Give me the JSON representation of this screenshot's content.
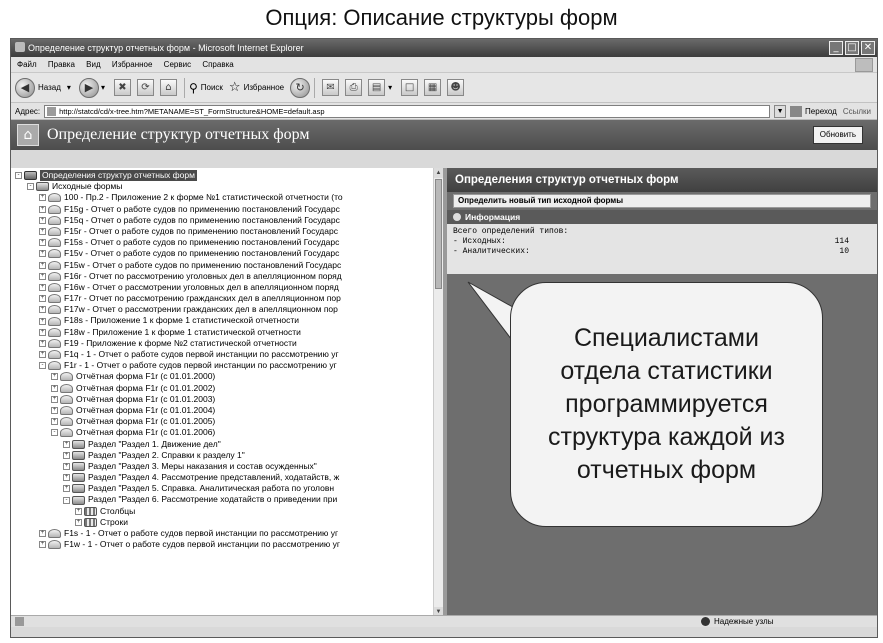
{
  "slide_title": "Опция: Описание структуры форм",
  "window": {
    "title": "Определение структур отчетных форм - Microsoft Internet Explorer",
    "controls": [
      "_",
      "□",
      "✕"
    ]
  },
  "menu": [
    "Файл",
    "Правка",
    "Вид",
    "Избранное",
    "Сервис",
    "Справка"
  ],
  "toolbar": {
    "back": "Назад",
    "search": "Поиск",
    "favorites": "Избранное"
  },
  "address": {
    "label": "Адрес:",
    "url": "http://statcd/cd/x-tree.htm?METANAME=ST_FormStructure&HOME=default.asp",
    "go": "Переход",
    "links": "Ссылки"
  },
  "app": {
    "title": "Определение структур отчетных форм",
    "refresh_label": "Обновить"
  },
  "tree": [
    {
      "exp": "-",
      "icon": "db",
      "label": "Определения структур отчетных форм",
      "indent": 0,
      "selected": true
    },
    {
      "exp": "-",
      "icon": "folder",
      "label": "Исходные формы",
      "indent": 1
    },
    {
      "exp": "+",
      "icon": "doc",
      "label": "100 - Пр.2 - Приложение 2 к форме №1 статистической отчетности (то",
      "indent": 2
    },
    {
      "exp": "+",
      "icon": "doc",
      "label": "F15g - Отчет о работе судов по применению постановлений Государс",
      "indent": 2
    },
    {
      "exp": "+",
      "icon": "doc",
      "label": "F15q - Отчет о работе судов по применению постановлений Государс",
      "indent": 2
    },
    {
      "exp": "+",
      "icon": "doc",
      "label": "F15r - Отчет о работе судов по применению постановлений Государс",
      "indent": 2
    },
    {
      "exp": "+",
      "icon": "doc",
      "label": "F15s - Отчет о работе судов по применению постановлений Государс",
      "indent": 2
    },
    {
      "exp": "+",
      "icon": "doc",
      "label": "F15v - Отчет о работе судов по применению постановлений Государс",
      "indent": 2
    },
    {
      "exp": "+",
      "icon": "doc",
      "label": "F15w - Отчет о работе судов по применению постановлений Государс",
      "indent": 2
    },
    {
      "exp": "+",
      "icon": "doc",
      "label": "F16r - Отчет по рассмотрению уголовных дел в апелляционном поряд",
      "indent": 2
    },
    {
      "exp": "+",
      "icon": "doc",
      "label": "F16w - Отчет о рассмотрении уголовных дел в апелляционном поряд",
      "indent": 2
    },
    {
      "exp": "+",
      "icon": "doc",
      "label": "F17r - Отчет по рассмотрению гражданских дел в апелляционном пор",
      "indent": 2
    },
    {
      "exp": "+",
      "icon": "doc",
      "label": "F17w - Отчет о рассмотрении гражданских дел в апелляционном пор",
      "indent": 2
    },
    {
      "exp": "+",
      "icon": "doc",
      "label": "F18s - Приложение 1 к форме 1 статистической отчетности",
      "indent": 2
    },
    {
      "exp": "+",
      "icon": "doc",
      "label": "F18w - Приложение 1 к форме 1 статистической отчетности",
      "indent": 2
    },
    {
      "exp": "+",
      "icon": "doc",
      "label": "F19 - Приложение к форме №2 статистической отчетности",
      "indent": 2
    },
    {
      "exp": "+",
      "icon": "doc",
      "label": "F1q - 1 - Отчет о работе судов первой инстанции по рассмотрению уг",
      "indent": 2
    },
    {
      "exp": "-",
      "icon": "doc",
      "label": "F1r - 1 - Отчет о работе судов первой инстанции по рассмотрению уг",
      "indent": 2
    },
    {
      "exp": "+",
      "icon": "doc",
      "label": "Отчётная форма F1r (с 01.01.2000)",
      "indent": 3
    },
    {
      "exp": "+",
      "icon": "doc",
      "label": "Отчётная форма F1r (с 01.01.2002)",
      "indent": 3
    },
    {
      "exp": "+",
      "icon": "doc",
      "label": "Отчётная форма F1r (с 01.01.2003)",
      "indent": 3
    },
    {
      "exp": "+",
      "icon": "doc",
      "label": "Отчётная форма F1r (с 01.01.2004)",
      "indent": 3
    },
    {
      "exp": "+",
      "icon": "doc",
      "label": "Отчётная форма F1r (с 01.01.2005)",
      "indent": 3
    },
    {
      "exp": "-",
      "icon": "doc",
      "label": "Отчётная форма F1r (с 01.01.2006)",
      "indent": 3
    },
    {
      "exp": "+",
      "icon": "folder",
      "label": "Раздел \"Раздел 1. Движение дел\"",
      "indent": 4
    },
    {
      "exp": "+",
      "icon": "folder",
      "label": "Раздел \"Раздел 2. Справки к разделу 1\"",
      "indent": 4
    },
    {
      "exp": "+",
      "icon": "folder",
      "label": "Раздел \"Раздел 3. Меры наказания и состав осужденных\"",
      "indent": 4
    },
    {
      "exp": "+",
      "icon": "folder",
      "label": "Раздел \"Раздел 4. Рассмотрение представлений, ходатайств, ж",
      "indent": 4
    },
    {
      "exp": "+",
      "icon": "folder",
      "label": "Раздел \"Раздел 5. Справка. Аналитическая работа по уголовн",
      "indent": 4
    },
    {
      "exp": "-",
      "icon": "folder",
      "label": "Раздел \"Раздел 6. Рассмотрение ходатайств о приведении при",
      "indent": 4
    },
    {
      "exp": "+",
      "icon": "grid",
      "label": "Столбцы",
      "indent": 5
    },
    {
      "exp": "+",
      "icon": "grid",
      "label": "Строки",
      "indent": 5
    },
    {
      "exp": "+",
      "icon": "doc",
      "label": "F1s - 1 - Отчет о работе судов первой инстанции по рассмотрению уг",
      "indent": 2
    },
    {
      "exp": "+",
      "icon": "doc",
      "label": "F1w - 1 - Отчет о работе судов первой инстанции по рассмотрению уг",
      "indent": 2
    }
  ],
  "right": {
    "header": "Определения структур отчетных форм",
    "define_button": "Определить новый тип исходной формы",
    "info_title": "Информация",
    "total_label": "Всего определений типов:",
    "rows": [
      {
        "label": "- Исходных:",
        "value": "114"
      },
      {
        "label": "- Аналитических:",
        "value": "10"
      }
    ]
  },
  "callout": {
    "lines": [
      "Специалистами",
      "отдела статистики",
      "программируется",
      "структура каждой из",
      "отчетных форм"
    ]
  },
  "status": {
    "zone": "Надежные узлы"
  }
}
